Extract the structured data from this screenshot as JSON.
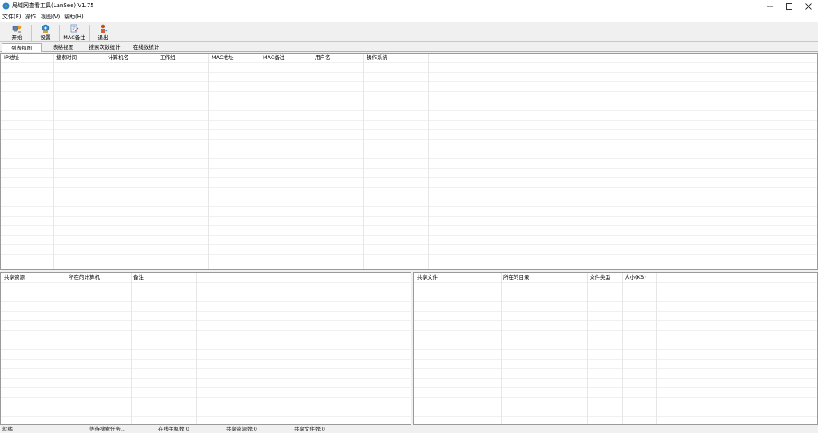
{
  "window": {
    "title": "局域网查看工具(LanSee) V1.75",
    "controls": {
      "minimize": "minimize-icon",
      "maximize": "maximize-icon",
      "close": "close-icon"
    }
  },
  "menu": {
    "items": [
      "文件(F)",
      "操作",
      "视图(V)",
      "帮助(H)"
    ]
  },
  "toolbar": {
    "buttons": [
      {
        "label": "开始",
        "icon": "start-icon"
      },
      {
        "label": "设置",
        "icon": "settings-icon"
      },
      {
        "label": "MAC备注",
        "icon": "mac-note-icon"
      },
      {
        "label": "退出",
        "icon": "exit-icon"
      }
    ]
  },
  "tabs": [
    "列表视图",
    "表格视图",
    "搜索次数统计",
    "在线数统计"
  ],
  "main_list": {
    "columns": [
      "IP地址",
      "搜索时间",
      "计算机名",
      "工作组",
      "MAC地址",
      "MAC备注",
      "用户名",
      "操作系统"
    ]
  },
  "share_list": {
    "columns": [
      "共享资源",
      "所在的计算机",
      "备注"
    ]
  },
  "file_list": {
    "columns": [
      "共享文件",
      "所在的目录",
      "文件类型",
      "大小(KB)"
    ]
  },
  "status": {
    "items": [
      "就绪",
      "等待搜索任务...",
      "在线主机数:0",
      "共享资源数:0",
      "共享文件数:0"
    ]
  },
  "colors": {
    "window_bg": "#f0f0f0",
    "list_bg": "#ffffff",
    "grid_line": "#f0f0f0"
  }
}
